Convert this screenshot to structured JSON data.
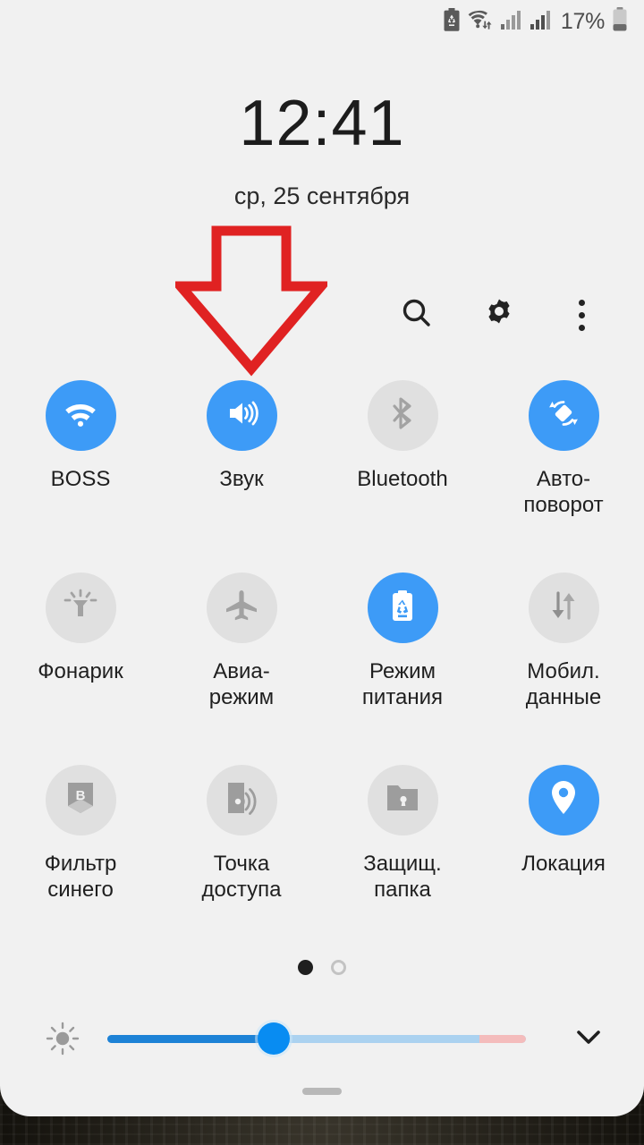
{
  "status_bar": {
    "icons": [
      "battery-saver-icon",
      "wifi-icon",
      "signal-sim1-icon",
      "signal-sim2-icon"
    ],
    "battery_percent": "17%",
    "battery_icon": "battery-low-icon"
  },
  "clock": {
    "time": "12:41",
    "date": "ср, 25 сентября"
  },
  "actions": [
    {
      "name": "search-button",
      "icon": "search-icon"
    },
    {
      "name": "settings-button",
      "icon": "gear-icon"
    },
    {
      "name": "more-options-button",
      "icon": "overflow-menu-icon"
    }
  ],
  "toggles": [
    {
      "label": "BOSS",
      "icon": "wifi-icon",
      "active": true
    },
    {
      "label": "Звук",
      "icon": "sound-icon",
      "active": true
    },
    {
      "label": "Bluetooth",
      "icon": "bluetooth-icon",
      "active": false
    },
    {
      "label": "Авто-\nповорот",
      "icon": "auto-rotate-icon",
      "active": true
    },
    {
      "label": "Фонарик",
      "icon": "flashlight-icon",
      "active": false
    },
    {
      "label": "Авиа-\nрежим",
      "icon": "airplane-icon",
      "active": false
    },
    {
      "label": "Режим\nпитания",
      "icon": "power-mode-icon",
      "active": true
    },
    {
      "label": "Мобил.\nданные",
      "icon": "mobile-data-icon",
      "active": false
    },
    {
      "label": "Фильтр\nсинего",
      "icon": "blue-light-icon",
      "active": false
    },
    {
      "label": "Точка\nдоступа",
      "icon": "hotspot-icon",
      "active": false
    },
    {
      "label": "Защищ.\nпапка",
      "icon": "secure-folder-icon",
      "active": false
    },
    {
      "label": "Локация",
      "icon": "location-pin-icon",
      "active": true
    }
  ],
  "pagination": {
    "pages": 2,
    "current": 1
  },
  "brightness": {
    "icon": "brightness-icon",
    "value_percent": 36,
    "expand_icon": "chevron-down-icon"
  },
  "annotation": {
    "type": "arrow-down",
    "color": "#e02222",
    "points_to": "Звук"
  },
  "colors": {
    "accent_on": "#3d9bf7",
    "tile_off": "#e0e0e0",
    "panel_bg": "#f1f1f1",
    "slider_fill": "#1d82d6",
    "slider_track": "#abd2f0",
    "slider_warn": "#f4bcbc",
    "annotation_red": "#e02222"
  }
}
